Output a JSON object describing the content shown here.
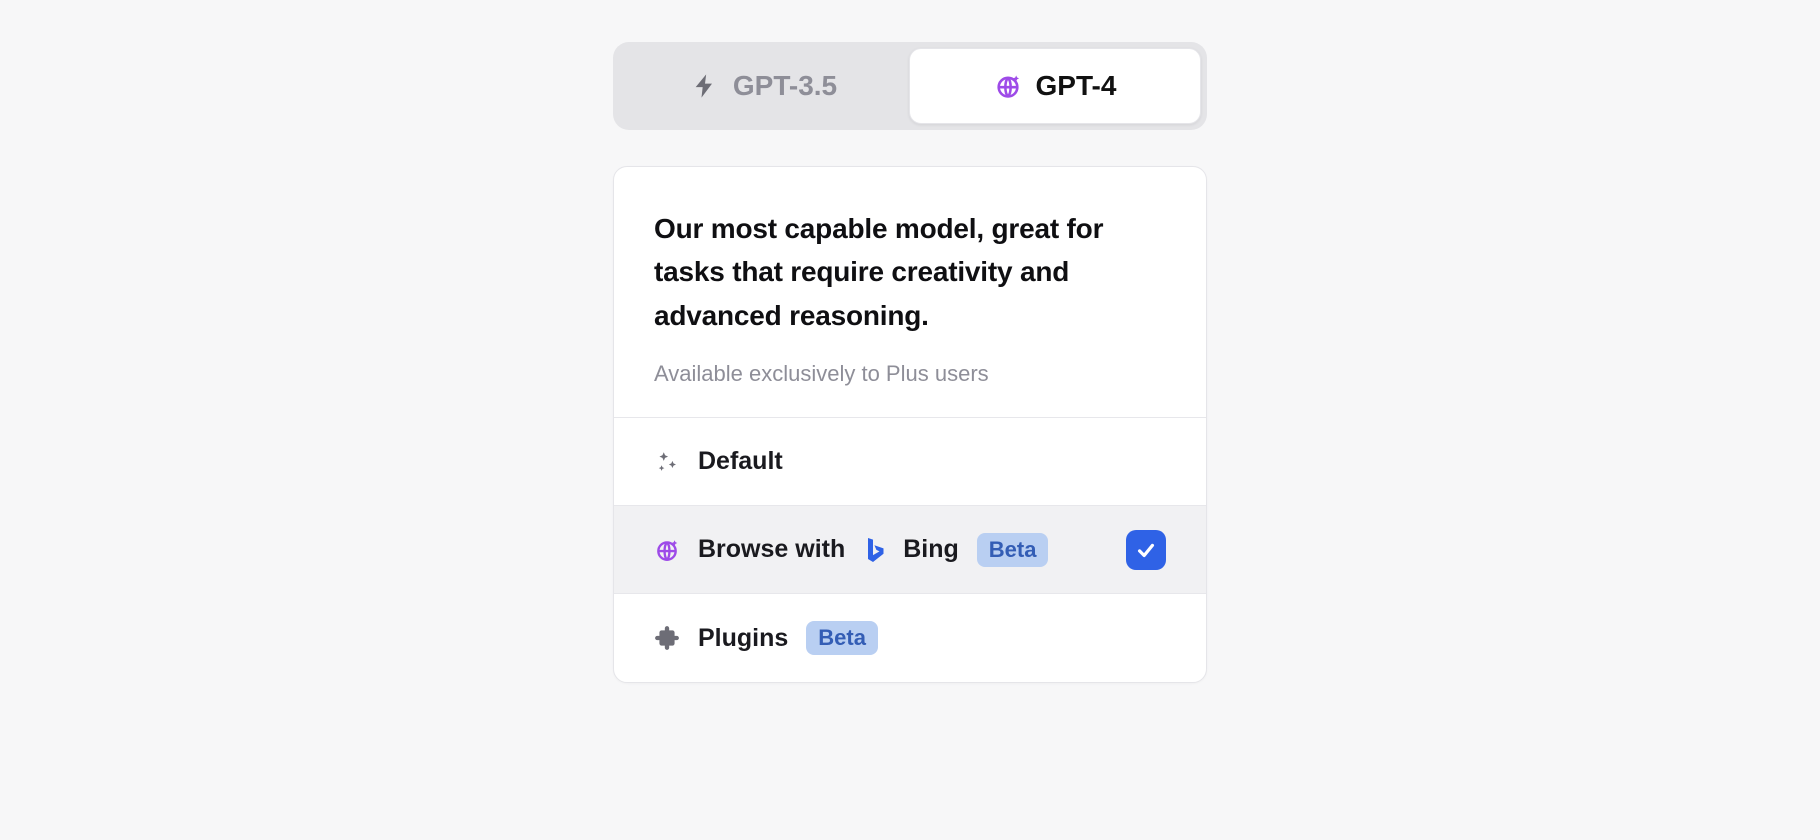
{
  "colors": {
    "accent_purple": "#9e4be8",
    "check_blue": "#2f62e6",
    "badge_bg": "#b9cff2",
    "badge_fg": "#335db5"
  },
  "model_tabs": {
    "left": {
      "label": "GPT-3.5",
      "icon": "lightning-icon",
      "active": false
    },
    "right": {
      "label": "GPT-4",
      "icon": "globe-sparkle-icon",
      "active": true
    }
  },
  "panel": {
    "description": "Our most capable model, great for tasks that require creativity and advanced reasoning.",
    "subtext": "Available exclusively to Plus users"
  },
  "options": [
    {
      "id": "default",
      "icon": "sparkles-icon",
      "label": "Default",
      "badge": null,
      "selected": false
    },
    {
      "id": "browse",
      "icon": "globe-sparkle-icon",
      "label_pre": "Browse with",
      "label_post": "Bing",
      "badge": "Beta",
      "selected": true
    },
    {
      "id": "plugins",
      "icon": "puzzle-icon",
      "label": "Plugins",
      "badge": "Beta",
      "selected": false
    }
  ]
}
